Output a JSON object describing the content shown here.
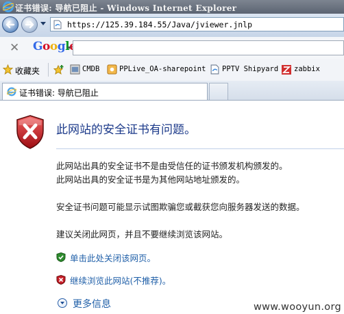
{
  "window": {
    "title": "证书错误: 导航已阻止 - Windows Internet Explorer"
  },
  "address_bar": {
    "url": "https://125.39.184.55/Java/jviewer.jnlp"
  },
  "google_toolbar": {
    "logo_text": "Google",
    "search_value": ""
  },
  "favorites": {
    "label": "收藏夹",
    "items": [
      {
        "label": "CMDB"
      },
      {
        "label": "PPLive_OA-sharepoint"
      },
      {
        "label": "PPTV Shipyard"
      },
      {
        "label": "zabbix"
      }
    ]
  },
  "tab": {
    "label": "证书错误: 导航已阻止"
  },
  "page": {
    "heading": "此网站的安全证书有问题。",
    "para1_line1": "此网站出具的安全证书不是由受信任的证书颁发机构颁发的。",
    "para1_line2": "此网站出具的安全证书是为其他网站地址颁发的。",
    "para2": "安全证书问题可能显示试图欺骗您或截获您向服务器发送的数据。",
    "para3": "建议关闭此网页，并且不要继续浏览该网站。",
    "close_link": "单击此处关闭该网页。",
    "continue_link": "继续浏览此网站(不推荐)。",
    "more_info": "更多信息"
  },
  "watermark": "www.wooyun.org",
  "colors": {
    "heading": "#1c3a8a",
    "link": "#1f5fa8",
    "error_red": "#c8202a",
    "ok_green": "#2e8b2e"
  }
}
